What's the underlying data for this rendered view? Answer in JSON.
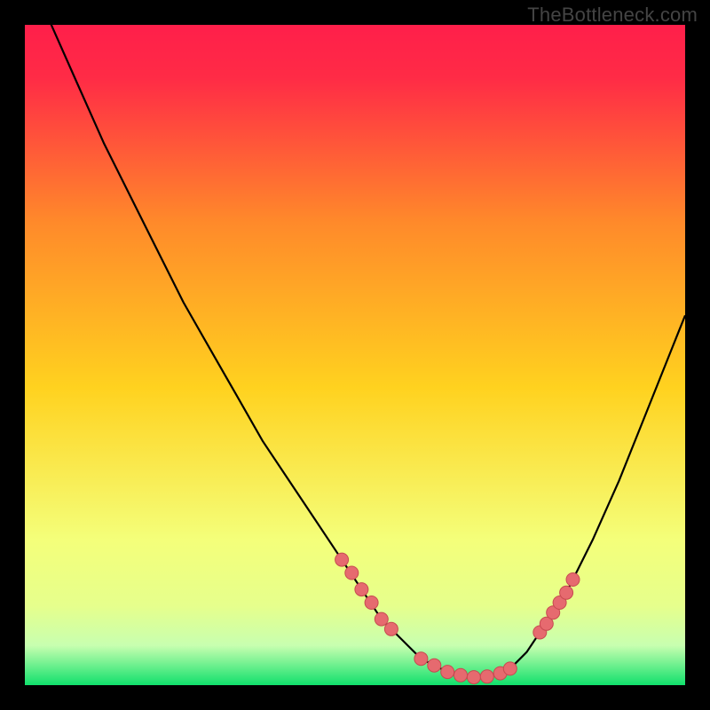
{
  "watermark": "TheBottleneck.com",
  "colors": {
    "bg": "#000000",
    "curve": "#000000",
    "marker_fill": "#e66a6f",
    "marker_stroke": "#c74a50",
    "gradient_top": "#ff1f4a",
    "gradient_mid": "#ffd21f",
    "gradient_low": "#f4ff7a",
    "gradient_pale": "#c8ffb0",
    "gradient_bottom": "#11e06c"
  },
  "chart_data": {
    "type": "line",
    "title": "",
    "xlabel": "",
    "ylabel": "",
    "xlim": [
      0,
      100
    ],
    "ylim": [
      0,
      100
    ],
    "series": [
      {
        "name": "bottleneck-curve",
        "x": [
          0,
          4,
          8,
          12,
          16,
          20,
          24,
          28,
          32,
          36,
          40,
          44,
          48,
          52,
          54,
          56,
          58,
          60,
          62,
          64,
          66,
          68,
          70,
          72,
          74,
          76,
          78,
          82,
          86,
          90,
          94,
          98,
          100
        ],
        "y": [
          110,
          100,
          91,
          82,
          74,
          66,
          58,
          51,
          44,
          37,
          31,
          25,
          19,
          13,
          10,
          8,
          6,
          4,
          3,
          2,
          1.5,
          1.2,
          1.3,
          1.8,
          3,
          5,
          8,
          14,
          22,
          31,
          41,
          51,
          56
        ]
      }
    ],
    "markers": {
      "name": "highlight-points",
      "x": [
        48,
        49.5,
        51,
        52.5,
        54,
        55.5,
        60,
        62,
        64,
        66,
        68,
        70,
        72,
        73.5,
        78,
        79,
        80,
        81,
        82,
        83
      ],
      "y": [
        19,
        17,
        14.5,
        12.5,
        10,
        8.5,
        4,
        3,
        2,
        1.5,
        1.2,
        1.3,
        1.8,
        2.5,
        8,
        9.3,
        11,
        12.5,
        14,
        16
      ]
    }
  }
}
